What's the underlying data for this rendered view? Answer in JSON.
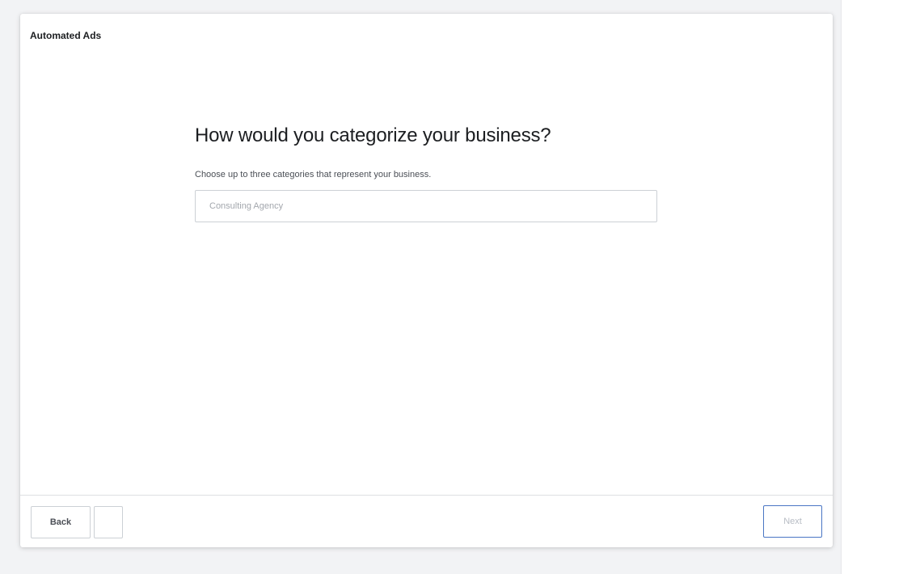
{
  "app": {
    "title": "Automated Ads"
  },
  "main": {
    "question": "How would you categorize your business?",
    "helper_text": "Choose up to three categories that represent your business.",
    "category_input": {
      "placeholder": "Consulting Agency",
      "value": ""
    }
  },
  "footer": {
    "back_label": "Back",
    "next_label": "Next"
  },
  "colors": {
    "next_border": "#4a76c4",
    "text_primary": "#1c1e21",
    "border": "#ccd0d5"
  }
}
